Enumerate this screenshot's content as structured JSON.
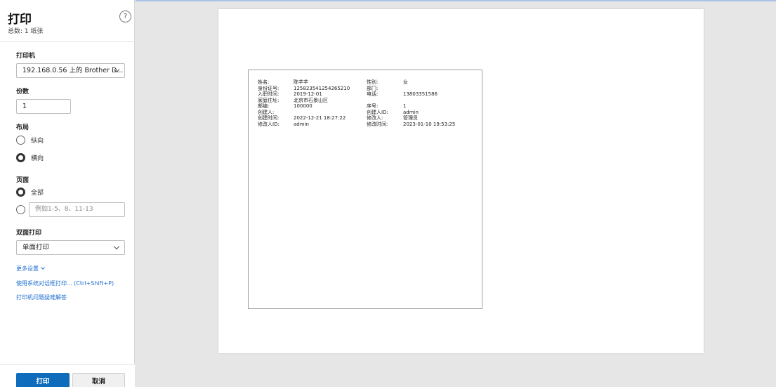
{
  "panel": {
    "title": "打印",
    "subtitle": "总数: 1 纸张",
    "help_label": "?",
    "printer": {
      "label": "打印机",
      "value": "192.168.0.56 上的 Brother D..."
    },
    "copies": {
      "label": "份数",
      "value": "1"
    },
    "layout": {
      "label": "布局",
      "options": [
        {
          "label": "纵向",
          "checked": false
        },
        {
          "label": "横向",
          "checked": true
        }
      ]
    },
    "pages": {
      "label": "页面",
      "all_label": "全部",
      "range_placeholder": "例如1-5、8、11-13"
    },
    "duplex": {
      "label": "双面打印",
      "value": "单面打印"
    },
    "more_settings": "更多设置",
    "system_dialog_link": "使用系统对话框打印... (Ctrl+Shift+P)",
    "troubleshoot_link": "打印机问题疑难解答",
    "print_button": "打印",
    "cancel_button": "取消"
  },
  "sheet": {
    "rows": [
      {
        "k1": "姓名:",
        "v1": "陈芊芊",
        "k2": "性别:",
        "v2": "女"
      },
      {
        "k1": "身份证号:",
        "v1": "125823541254265210",
        "k2": "部门:",
        "v2": ""
      },
      {
        "k1": "入职时间:",
        "v1": "2019-12-01",
        "k2": "电话:",
        "v2": "13803351586"
      },
      {
        "k1": "家庭住址:",
        "v1": "北京市石景山区",
        "k2": "",
        "v2": ""
      },
      {
        "k1": "邮编:",
        "v1": "100000",
        "k2": "序号:",
        "v2": "1"
      },
      {
        "k1": "创建人:",
        "v1": "",
        "k2": "创建人ID:",
        "v2": "admin"
      },
      {
        "k1": "创建时间:",
        "v1": "2022-12-21 18:27:22",
        "k2": "修改人:",
        "v2": "管理员"
      },
      {
        "k1": "修改人ID:",
        "v1": "admin",
        "k2": "修改时间:",
        "v2": "2023-01-10 19:53:25"
      }
    ]
  },
  "colors": {
    "accent": "#0f6cbd",
    "link": "#1e6fd0"
  }
}
